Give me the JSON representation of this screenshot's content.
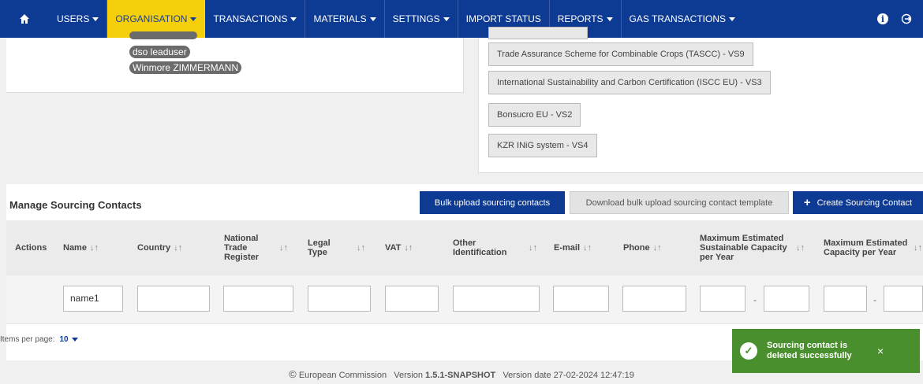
{
  "nav": {
    "items": [
      {
        "label": "USERS",
        "dropdown": true
      },
      {
        "label": "ORGANISATION",
        "dropdown": true,
        "active": true
      },
      {
        "label": "TRANSACTIONS",
        "dropdown": true
      },
      {
        "label": "MATERIALS",
        "dropdown": true
      },
      {
        "label": "SETTINGS",
        "dropdown": true
      },
      {
        "label": "IMPORT STATUS",
        "dropdown": false
      },
      {
        "label": "REPORTS",
        "dropdown": true
      },
      {
        "label": "GAS TRANSACTIONS",
        "dropdown": true
      }
    ],
    "info_glyph": "i",
    "logout_glyph": "⇥"
  },
  "users_panel": {
    "tags": [
      "dso leaduser",
      "Winmore ZIMMERMANN"
    ]
  },
  "schemes_panel": {
    "items": [
      "Trade Assurance Scheme for Combinable Crops (TASCC) - VS9",
      "International Sustainability and Carbon Certification (ISCC EU) - VS3",
      "Bonsucro EU - VS2",
      "KZR INiG system - VS4"
    ]
  },
  "sourcing": {
    "title": "Manage Sourcing Contacts",
    "bulk_upload_label": "Bulk upload sourcing contacts",
    "download_template_label": "Download bulk upload sourcing contact template",
    "create_label": "Create Sourcing Contact",
    "columns": {
      "actions": "Actions",
      "name": "Name",
      "country": "Country",
      "ntr": "National Trade Register",
      "legal_type": "Legal Type",
      "vat": "VAT",
      "other_id": "Other Identification",
      "email": "E-mail",
      "phone": "Phone",
      "max_sust": "Maximum Estimated Sustainable Capacity per Year",
      "max_cap": "Maximum Estimated Capacity per Year"
    },
    "sort_glyph": "↓↑",
    "filters": {
      "name": "name1",
      "range_separator": "-"
    },
    "paging": {
      "label": "Items per page:",
      "value": "10"
    }
  },
  "footer": {
    "copyright_glyph": "©",
    "org": "European Commission",
    "version_label": "Version",
    "version": "1.5.1-SNAPSHOT",
    "date_label": "Version date",
    "date": "27-02-2024 12:47:19"
  },
  "toast": {
    "message": "Sourcing contact is deleted successfully",
    "close_glyph": "×",
    "check_glyph": "✓"
  },
  "colors": {
    "nav": "#0d3a93",
    "active": "#f5d00a",
    "toast": "#4a8f2e"
  }
}
